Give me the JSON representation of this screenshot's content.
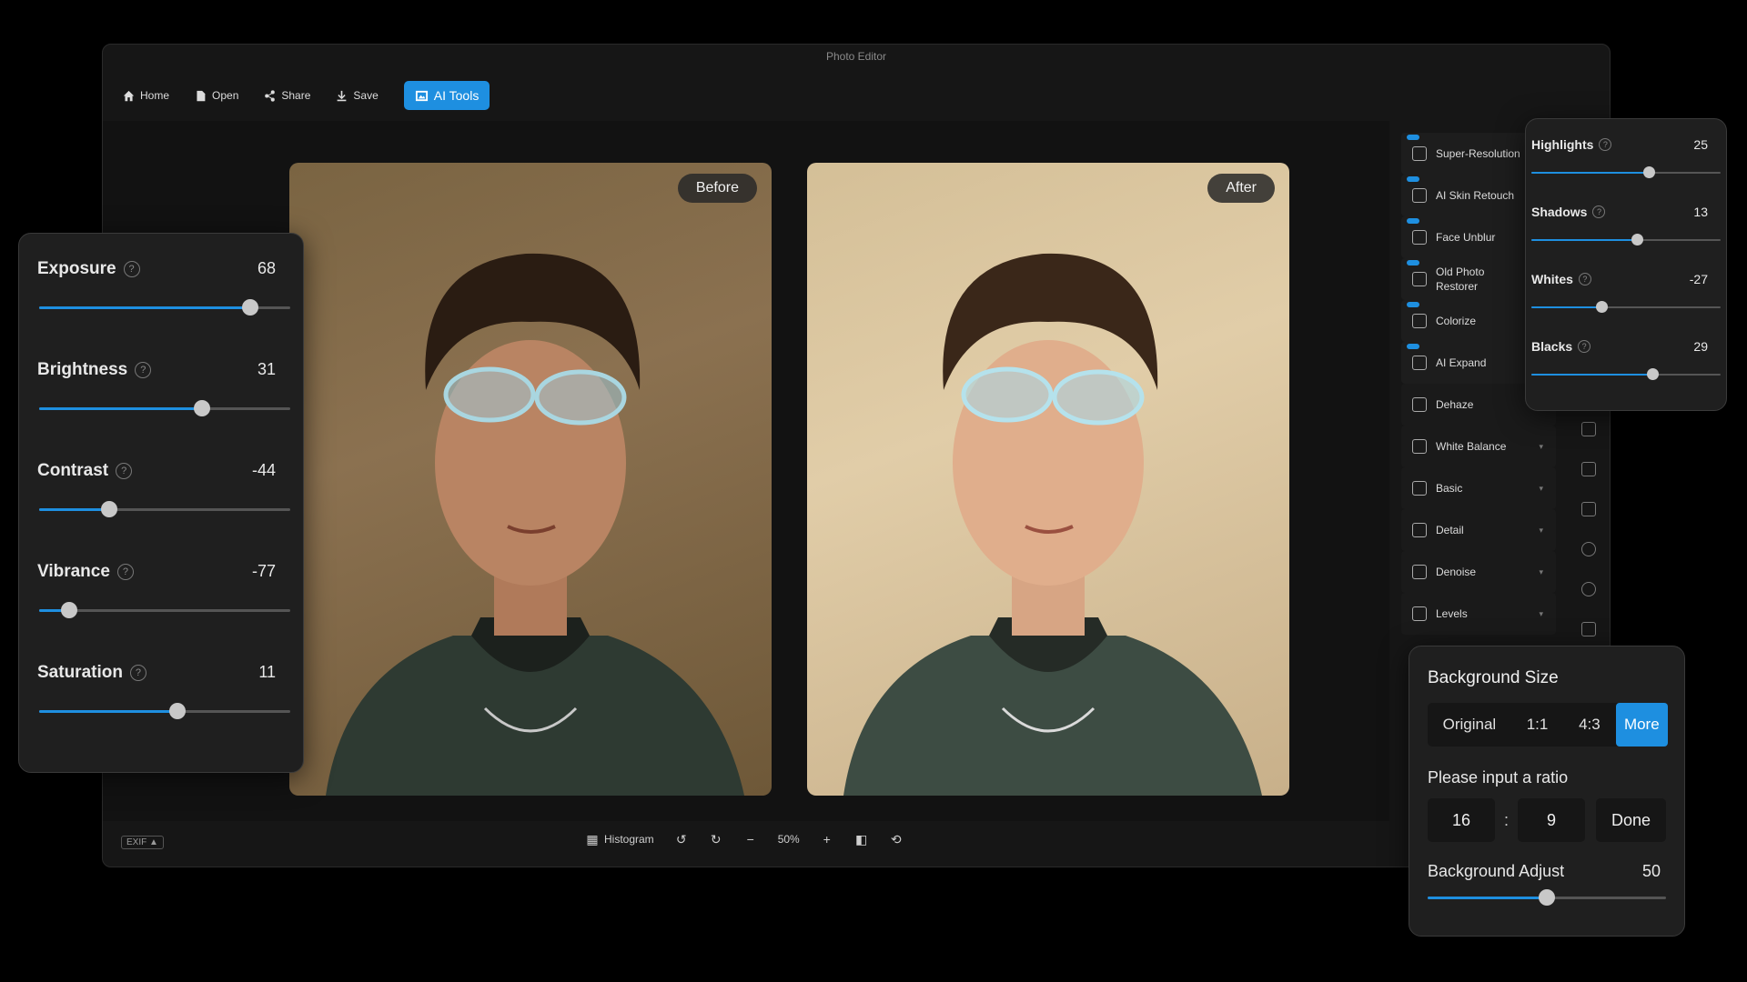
{
  "window": {
    "title": "Photo Editor"
  },
  "toolbar": {
    "home": "Home",
    "open": "Open",
    "share": "Share",
    "save": "Save",
    "ai_tools": "AI Tools"
  },
  "photos": {
    "before_label": "Before",
    "after_label": "After"
  },
  "bottom_bar": {
    "exif": "EXIF ▲",
    "histogram": "Histogram",
    "zoom": "50%"
  },
  "tools": [
    {
      "label": "Super-Resolution",
      "ai": true
    },
    {
      "label": "AI Skin Retouch",
      "ai": true
    },
    {
      "label": "Face Unblur",
      "ai": true
    },
    {
      "label": "Old Photo Restorer",
      "ai": true
    },
    {
      "label": "Colorize",
      "ai": true
    },
    {
      "label": "AI Expand",
      "ai": true
    },
    {
      "label": "Dehaze",
      "ai": false
    },
    {
      "label": "White Balance",
      "ai": false,
      "expand": true
    },
    {
      "label": "Basic",
      "ai": false,
      "expand": true
    },
    {
      "label": "Detail",
      "ai": false,
      "expand": true
    },
    {
      "label": "Denoise",
      "ai": false,
      "expand": true
    },
    {
      "label": "Levels",
      "ai": false,
      "expand": true
    }
  ],
  "left_adjust": [
    {
      "label": "Exposure",
      "value": "68",
      "level": 0.84
    },
    {
      "label": "Brightness",
      "value": "31",
      "level": 0.65
    },
    {
      "label": "Contrast",
      "value": "-44",
      "level": 0.28
    },
    {
      "label": "Vibrance",
      "value": "-77",
      "level": 0.12
    },
    {
      "label": "Saturation",
      "value": "11",
      "level": 0.55
    }
  ],
  "right_adjust": [
    {
      "label": "Highlights",
      "value": "25",
      "level": 0.62
    },
    {
      "label": "Shadows",
      "value": "13",
      "level": 0.56
    },
    {
      "label": "Whites",
      "value": "-27",
      "level": 0.37
    },
    {
      "label": "Blacks",
      "value": "29",
      "level": 0.64
    }
  ],
  "bg_size": {
    "title": "Background Size",
    "tabs": [
      "Original",
      "1:1",
      "4:3",
      "More"
    ],
    "active_tab": 3,
    "prompt": "Please input a ratio",
    "ratio_w": "16",
    "ratio_h": "9",
    "done": "Done",
    "adjust_label": "Background Adjust",
    "adjust_value": "50",
    "adjust_level": 0.5
  },
  "colors": {
    "accent": "#1e8fe0",
    "panel": "#1f1f1f",
    "window": "#161616"
  }
}
